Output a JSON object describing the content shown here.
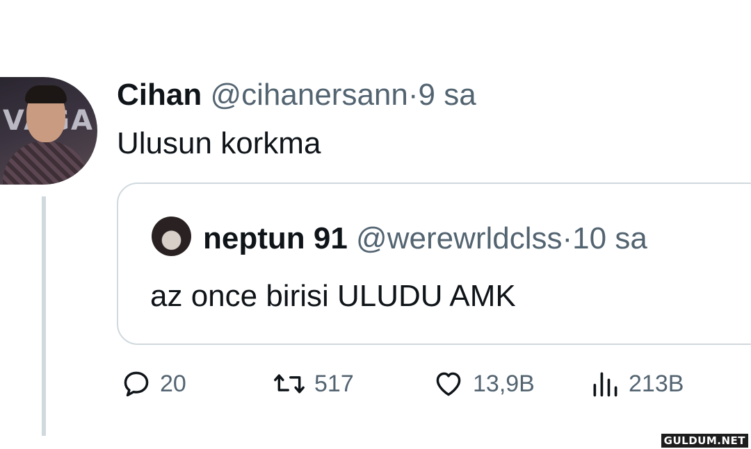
{
  "tweet": {
    "author_name": "Cihan",
    "author_handle": "@cihanersann",
    "separator": "·",
    "time": "9 sa",
    "text": "Ulusun korkma",
    "avatar_bg_text": "VAGA"
  },
  "quoted_tweet": {
    "author_name": "neptun 91",
    "author_handle": "@werewrldclss",
    "separator": "·",
    "time": "10 sa",
    "text": "az once birisi ULUDU AMK"
  },
  "actions": {
    "reply": {
      "icon": "reply-icon",
      "count": "20"
    },
    "retweet": {
      "icon": "retweet-icon",
      "count": "517"
    },
    "like": {
      "icon": "heart-icon",
      "count": "13,9B"
    },
    "views": {
      "icon": "views-icon",
      "count": "213B"
    }
  },
  "watermark": "GULDUM.NET",
  "colors": {
    "text_primary": "#0f1419",
    "text_secondary": "#536471",
    "border": "#cfd9de"
  }
}
